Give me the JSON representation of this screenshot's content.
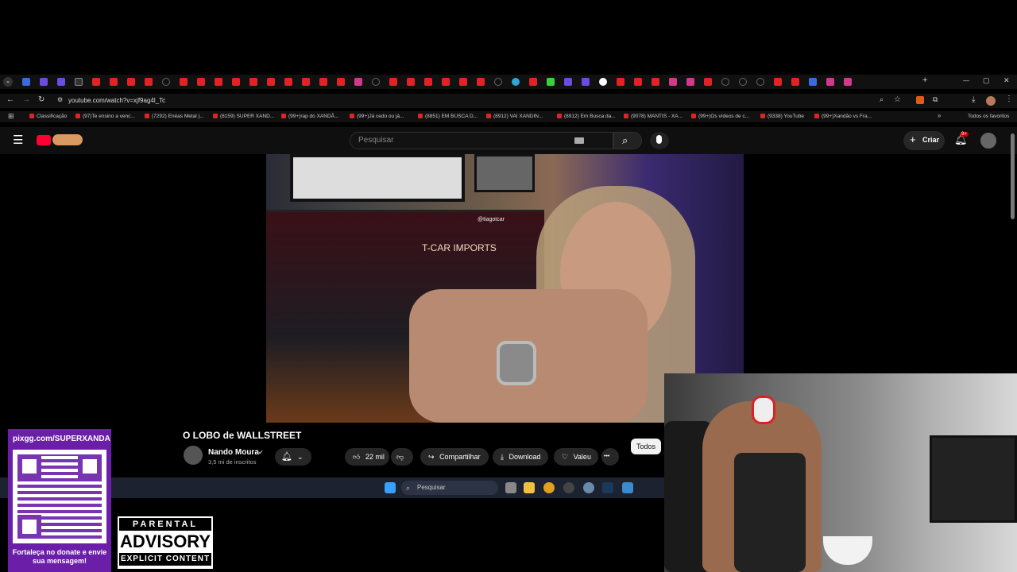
{
  "browser": {
    "url": "youtube.com/watch?v=xjf9ag4l_Tc",
    "bookmarks": [
      "Classificação",
      "(97)Te ensino a venc...",
      "(7292) Enéas Metal |...",
      "(8159) SUPER XAND...",
      "(99+)rap do XANDÃ...",
      "(99+)Já cedo ou já...",
      "(8851) EM BUSCA D...",
      "(8912) VAI XANDIN...",
      "(8912) Em Busca da...",
      "(9078) MANTIS - XA...",
      "(99+)Os vídeos de c...",
      "(9338) YouTube",
      "(99+)Xandão vs Fra..."
    ],
    "bookmarks_all": "Todos os favoritos",
    "tab_glyph_close": "✕",
    "new_tab": "+",
    "window_controls": [
      "—",
      "▢",
      "✕"
    ]
  },
  "youtube": {
    "search_placeholder": "Pesquisar",
    "create_label": "Criar",
    "notif_badge": "9+",
    "video_title": "O LOBO de WALLSTREET",
    "channel_name": "Nando Moura",
    "subscribers": "3,5 mi de inscritos",
    "likes": "22 mil",
    "share_label": "Compartilhar",
    "download_label": "Download",
    "thanks_label": "Valeu",
    "more_label": "•••",
    "filter_all": "Todos",
    "in_video_text": [
      "T-CAR IMPORTS",
      "@tiagotcar"
    ]
  },
  "taskbar": {
    "search_placeholder": "Pesquisar"
  },
  "overlay": {
    "donate_url": "pixgg.com/SUPERXANDA",
    "donate_message": "Fortaleça no donate e envie sua mensagem!",
    "advisory_line1": "PARENTAL",
    "advisory_line2": "ADVISORY",
    "advisory_line3": "EXPLICIT CONTENT"
  },
  "colors": {
    "youtube_red": "#ff0033",
    "donate_panel": "#6b1fa8",
    "page_bg": "#000000"
  }
}
